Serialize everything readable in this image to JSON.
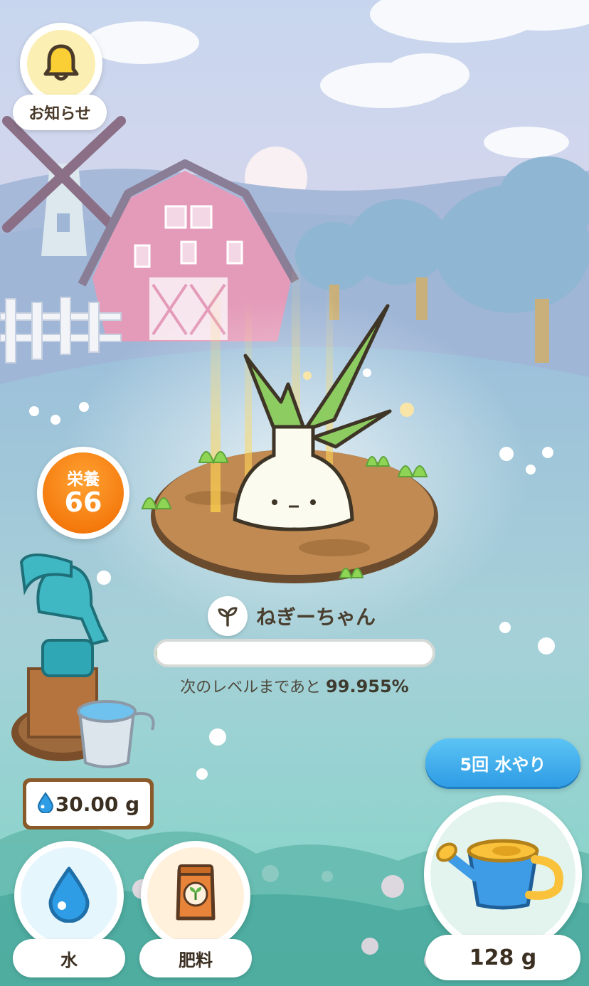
{
  "notification": {
    "label": "お知らせ",
    "icon": "bell-icon"
  },
  "nutrition": {
    "label": "栄養",
    "value": "66",
    "color": "#F57B0E"
  },
  "plant": {
    "name": "ねぎーちゃん",
    "icon": "sprout-icon",
    "progress_percent": 0.045,
    "progress_prefix": "次のレベルまであと",
    "progress_value": "99.955%"
  },
  "water_store": {
    "icon": "water-drop-icon",
    "amount": "30.00 g"
  },
  "water_action": {
    "label": "5回 水やり",
    "color": "#2F9CE6"
  },
  "bottom": {
    "water_label": "水",
    "fertilizer_label": "肥料",
    "can_amount": "128 g"
  }
}
